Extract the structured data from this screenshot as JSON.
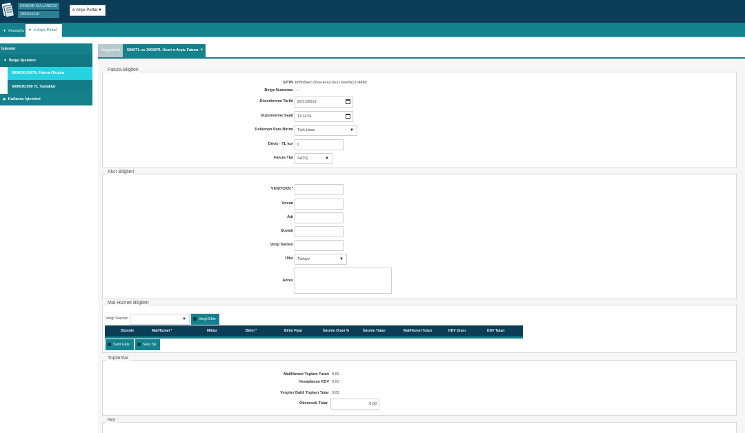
{
  "header": {
    "user_name": "DENEME KULLANICISI",
    "user_id": "2800546248",
    "portal_select": "e-Arşiv Portal"
  },
  "topnav": {
    "home": "Anasayfa",
    "portal": "e-Arşiv Portal"
  },
  "sidebar": {
    "title": "İşlemler",
    "belge": "Belge İşlemleri",
    "sub1": "5000/30.000TL Fatura Oluştur",
    "sub2": "5000/30.000 TL Taslaklar",
    "kullanici": "Kullanıcı İşlemleri"
  },
  "tabs": {
    "welcome": "Hoşgeldiniz",
    "fatura": "5000TL ve 30000TL Üzeri e-Arşiv Fatura",
    "close": "×"
  },
  "fatura": {
    "legend": "Fatura Bilgileri",
    "ettn_label": "ETTN",
    "ettn": "b85b8aec-30ce-4ca2-9e11-6ee5a21c448d",
    "belge_no_label": "Belge Numarası",
    "belge_no": "----",
    "tarih_label": "Düzenlenme Tarihi",
    "tarih": "20/12/2019",
    "saat_label": "Düzenlenme Saati",
    "saat": "11:14:51",
    "para_label": "Doküman Para Birimi",
    "para": "Türk Lirası",
    "doviz_label": "Döviz - TL kur",
    "doviz": "0",
    "tip_label": "Fatura Tipi",
    "tip": "SATIŞ"
  },
  "alici": {
    "legend": "Alıcı Bilgileri",
    "vkn_label": "VKN/TCKN *",
    "unvan_label": "Unvan",
    "adi_label": "Adı",
    "soyadi_label": "Soyadı",
    "vd_label": "Vergi Dairesi",
    "ulke_label": "Ülke",
    "ulke": "Türkiye",
    "adres_label": "Adres"
  },
  "mal": {
    "legend": "Mal Hizmet Bilgileri",
    "vergi_label": "Vergi Seçiniz:",
    "vergi_ekle": "Vergi Ekle",
    "cols": [
      "Düzenle",
      "Mal/Hizmet *",
      "Miktar",
      "Birim *",
      "Birim Fiyat",
      "İskonto Oranı %",
      "İskonto Tutarı",
      "Mal/Hizmet Tutarı",
      "KDV Oranı",
      "KDV Tutarı"
    ],
    "satir_ekle": "Satır Ekle",
    "satir_sil": "Satır Sil"
  },
  "toplamlar": {
    "legend": "Toplamlar",
    "mal_label": "Mal/Hizmet Toplam Tutarı",
    "mal": "0,00",
    "kdv_label": "Hesaplanan KDV",
    "kdv": "0,00",
    "vergiler_label": "Vergiler Dahil Toplam Tutar",
    "vergiler": "0,00",
    "odenecek_label": "Ödenecek Tutar",
    "odenecek": "0,00"
  },
  "not": {
    "legend": "Not"
  },
  "colors": {
    "header": "#0c3d57",
    "accent": "#15818c",
    "active": "#26d2e0"
  }
}
